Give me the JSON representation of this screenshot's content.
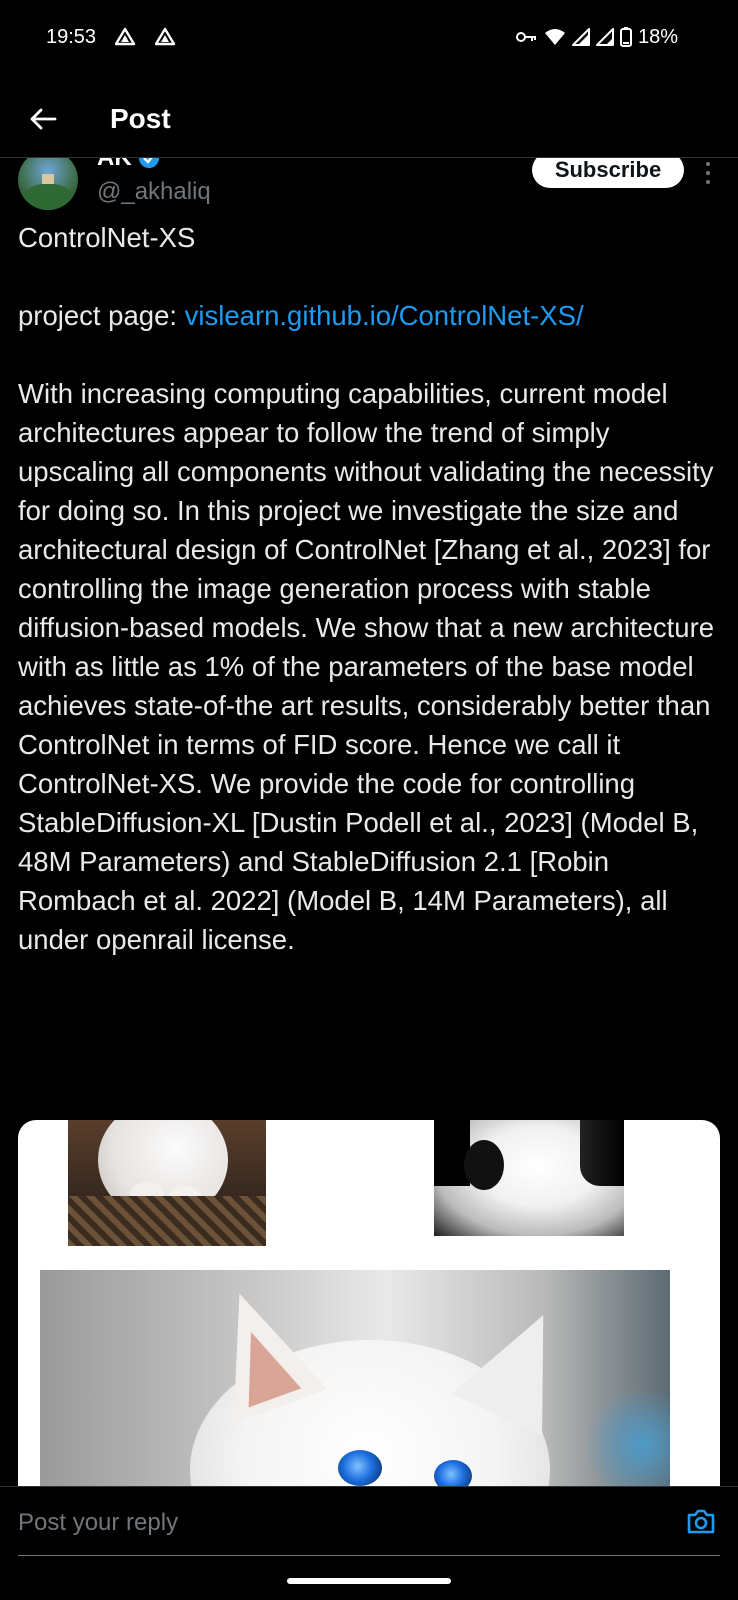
{
  "status_bar": {
    "time": "19:53",
    "battery": "18%",
    "icons": [
      "drive-icon",
      "drive-icon",
      "key-icon",
      "wifi-icon",
      "signal-icon",
      "signal-icon",
      "battery-icon"
    ]
  },
  "header": {
    "back_icon": "arrow-left-icon",
    "title": "Post"
  },
  "author": {
    "name": "AK",
    "verified": true,
    "handle": "@_akhaliq",
    "subscribe_label": "Subscribe",
    "more_icon": "more-vertical-icon"
  },
  "post": {
    "title_line": "ControlNet-XS",
    "project_prefix": "project page: ",
    "project_link": "vislearn.github.io/ControlNet-XS/",
    "body": "With increasing computing capabilities, current model architectures appear to follow the trend of simply upscaling all components without validating the necessity for doing so. In this project we investigate the size and architectural design of ControlNet [Zhang et al., 2023] for controlling the image generation process with stable diffusion-based models. We show that a new architecture with as little as 1% of the parameters of the base model achieves state-of-the art results, considerably better than ControlNet in terms of FID score. Hence we call it ControlNet-XS. We provide the code for controlling StableDiffusion-XL [Dustin Podell et al., 2023] (Model B, 48M Parameters) and StableDiffusion 2.1 [Robin Rombach et al. 2022] (Model B, 14M Parameters), all under openrail license."
  },
  "reply": {
    "placeholder": "Post your reply",
    "camera_icon": "camera-icon"
  },
  "colors": {
    "background": "#000000",
    "text": "#e7e9ea",
    "muted": "#71767b",
    "link": "#1d9bf0",
    "verified": "#1d9bf0"
  }
}
